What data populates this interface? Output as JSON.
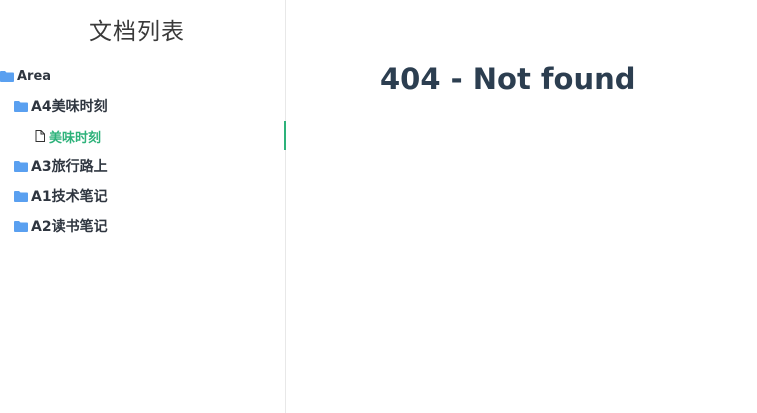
{
  "sidebar": {
    "title": "文档列表",
    "tree": {
      "root": {
        "label": "Area",
        "icon": "folder-icon"
      },
      "items": [
        {
          "label": "A4美味时刻",
          "icon": "folder-icon"
        },
        {
          "label": "美味时刻",
          "icon": "file-icon",
          "active": true
        },
        {
          "label": "A3旅行路上",
          "icon": "folder-icon"
        },
        {
          "label": "A1技术笔记",
          "icon": "folder-icon"
        },
        {
          "label": "A2读书笔记",
          "icon": "folder-icon"
        }
      ]
    }
  },
  "main": {
    "title": "404 - Not found"
  },
  "colors": {
    "accent": "#2db27a",
    "folder": "#5aa0f0",
    "text": "#2f3640",
    "heading": "#2c3e50",
    "border": "#e8e8e8"
  }
}
